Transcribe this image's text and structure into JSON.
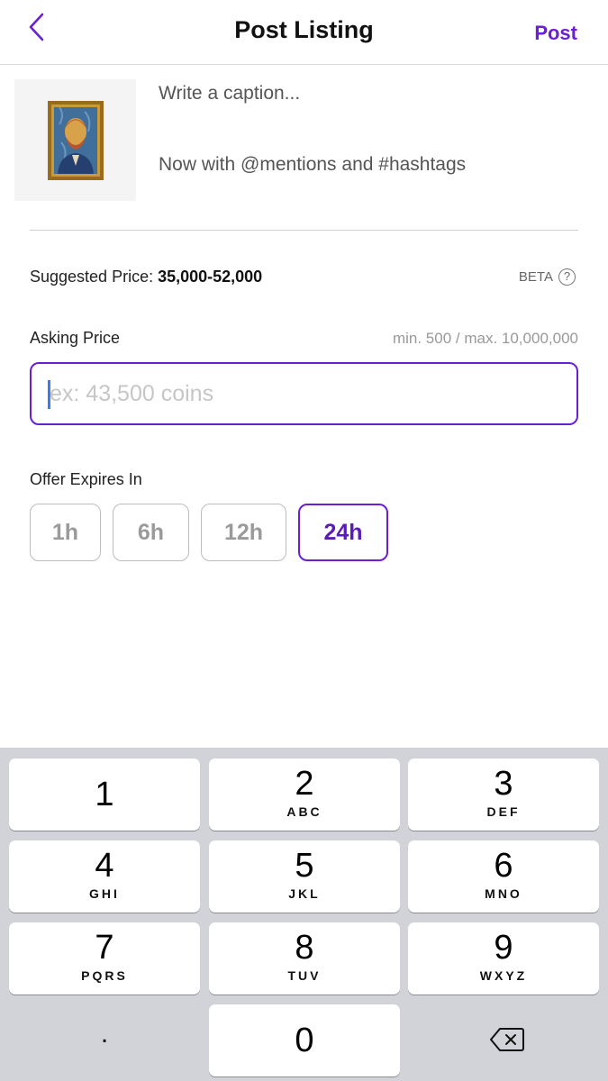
{
  "header": {
    "title": "Post Listing",
    "post_label": "Post",
    "accent_color": "#6a1fd1",
    "back_icon": "chevron-left-icon"
  },
  "caption": {
    "placeholder_line1": "Write a caption...",
    "placeholder_line2": "Now with @mentions and #hashtags"
  },
  "suggested": {
    "label": "Suggested Price: ",
    "range": "35,000-52,000",
    "beta": "BETA",
    "help": "?"
  },
  "asking": {
    "label": "Asking Price",
    "hint": "min. 500 / max. 10,000,000",
    "placeholder": "ex: 43,500 coins"
  },
  "offer": {
    "label": "Offer Expires In",
    "options": [
      "1h",
      "6h",
      "12h",
      "24h"
    ],
    "selected": "24h"
  },
  "keypad": {
    "keys": [
      {
        "num": "1",
        "letters": ""
      },
      {
        "num": "2",
        "letters": "ABC"
      },
      {
        "num": "3",
        "letters": "DEF"
      },
      {
        "num": "4",
        "letters": "GHI"
      },
      {
        "num": "5",
        "letters": "JKL"
      },
      {
        "num": "6",
        "letters": "MNO"
      },
      {
        "num": "7",
        "letters": "PQRS"
      },
      {
        "num": "8",
        "letters": "TUV"
      },
      {
        "num": "9",
        "letters": "WXYZ"
      },
      {
        "num": "0",
        "letters": ""
      }
    ],
    "decimal": ".",
    "delete_icon": "backspace-icon"
  }
}
